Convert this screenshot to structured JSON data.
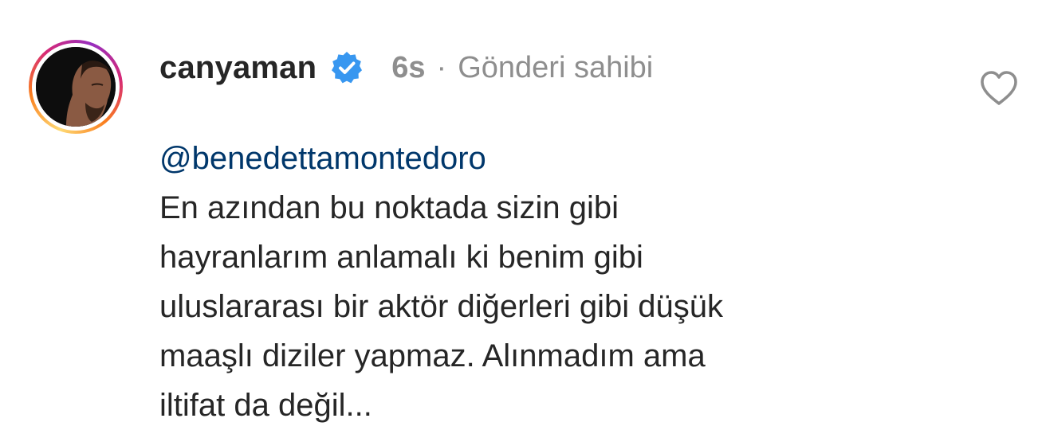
{
  "comment": {
    "username": "canyaman",
    "verified": true,
    "time": "6s",
    "separator": "·",
    "owner_label": "Gönderi sahibi",
    "mention": "@benedettamontedoro",
    "lines": [
      "En azından bu noktada sizin gibi",
      "hayranlarım anlamalı ki benim gibi",
      "uluslararası bir aktör diğerleri gibi düşük",
      "maaşlı diziler yapmaz. Alınmadım ama",
      "iltifat da değil..."
    ]
  },
  "icons": {
    "verified": "verified-badge-icon",
    "like": "heart-outline-icon"
  },
  "colors": {
    "text": "#262626",
    "muted": "#8e8e8e",
    "mention": "#00376b",
    "verified": "#3897f0"
  }
}
